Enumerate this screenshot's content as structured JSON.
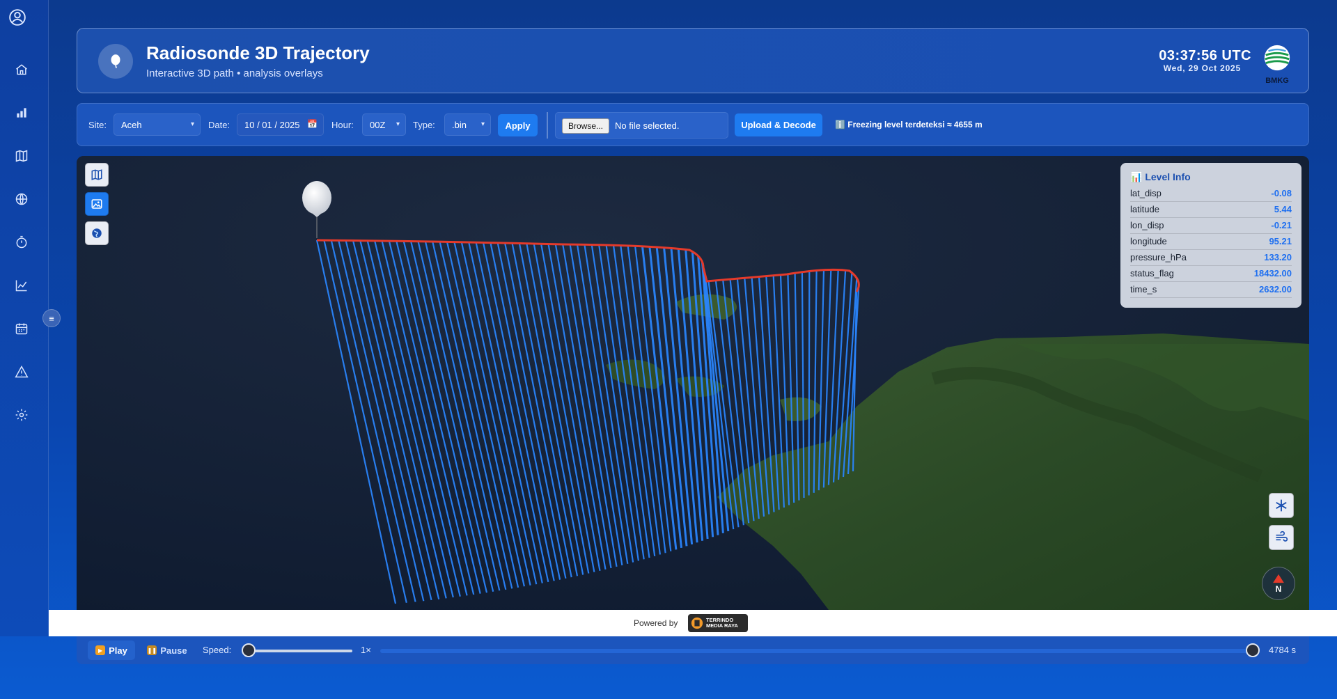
{
  "header": {
    "title": "Radiosonde 3D Trajectory",
    "subtitle": "Interactive 3D path • analysis overlays",
    "time": "03:37:56 UTC",
    "date": "Wed, 29 Oct 2025",
    "brand_label": "BMKG"
  },
  "toolbar": {
    "site_label": "Site:",
    "site_value": "Aceh",
    "date_label": "Date:",
    "date_value": "10 / 01 / 2025",
    "hour_label": "Hour:",
    "hour_value": "00Z",
    "type_label": "Type:",
    "type_value": ".bin",
    "apply_label": "Apply",
    "browse_label": "Browse...",
    "file_status": "No file selected.",
    "upload_label": "Upload & Decode",
    "freeze_info": "ℹ️ Freezing level terdeteksi ≈ 4655 m"
  },
  "level_info": {
    "title": "📊 Level Info",
    "rows": [
      {
        "key": "lat_disp",
        "value": "-0.08"
      },
      {
        "key": "latitude",
        "value": "5.44"
      },
      {
        "key": "lon_disp",
        "value": "-0.21"
      },
      {
        "key": "longitude",
        "value": "95.21"
      },
      {
        "key": "pressure_hPa",
        "value": "133.20"
      },
      {
        "key": "status_flag",
        "value": "18432.00"
      },
      {
        "key": "time_s",
        "value": "2632.00"
      }
    ]
  },
  "compass": {
    "label": "N"
  },
  "footer": {
    "powered_by": "Powered by",
    "partner_line1": "TERRINDO",
    "partner_line2": "MEDIA RAYA"
  },
  "playback": {
    "play_label": "Play",
    "pause_label": "Pause",
    "speed_label": "Speed:",
    "speed_value": "1×",
    "time_value": "4784 s",
    "speed_fraction": 0.0,
    "progress_fraction": 1.0
  },
  "colors": {
    "accent": "#1e7bf0",
    "trajectory": "#e53a2a",
    "curtain": "#2a86ff",
    "background": "#0a46b0"
  }
}
